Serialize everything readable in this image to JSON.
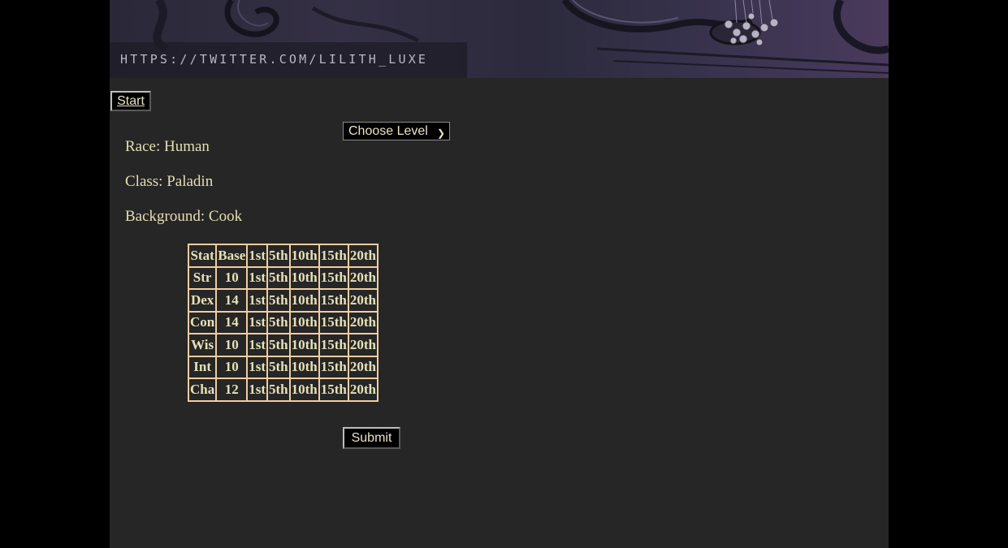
{
  "banner": {
    "url_text": "HTTPS://TWITTER.COM/LILITH_LUXE"
  },
  "nav": {
    "start_label": "Start"
  },
  "level_select": {
    "selected": "Choose Level"
  },
  "character": {
    "race": "Race: Human",
    "class": "Class: Paladin",
    "background": "Background: Cook"
  },
  "stats_table": {
    "headers": [
      "Stat",
      "Base",
      "1st",
      "5th",
      "10th",
      "15th",
      "20th"
    ],
    "rows": [
      [
        "Str",
        "10",
        "1st",
        "5th",
        "10th",
        "15th",
        "20th"
      ],
      [
        "Dex",
        "14",
        "1st",
        "5th",
        "10th",
        "15th",
        "20th"
      ],
      [
        "Con",
        "14",
        "1st",
        "5th",
        "10th",
        "15th",
        "20th"
      ],
      [
        "Wis",
        "10",
        "1st",
        "5th",
        "10th",
        "15th",
        "20th"
      ],
      [
        "Int",
        "10",
        "1st",
        "5th",
        "10th",
        "15th",
        "20th"
      ],
      [
        "Cha",
        "12",
        "1st",
        "5th",
        "10th",
        "15th",
        "20th"
      ]
    ]
  },
  "form": {
    "submit_label": "Submit"
  },
  "colors": {
    "page_bg": "#262626",
    "outer_bg": "#000000",
    "text": "#e4dfb4",
    "table_border": "#f0cda0"
  }
}
